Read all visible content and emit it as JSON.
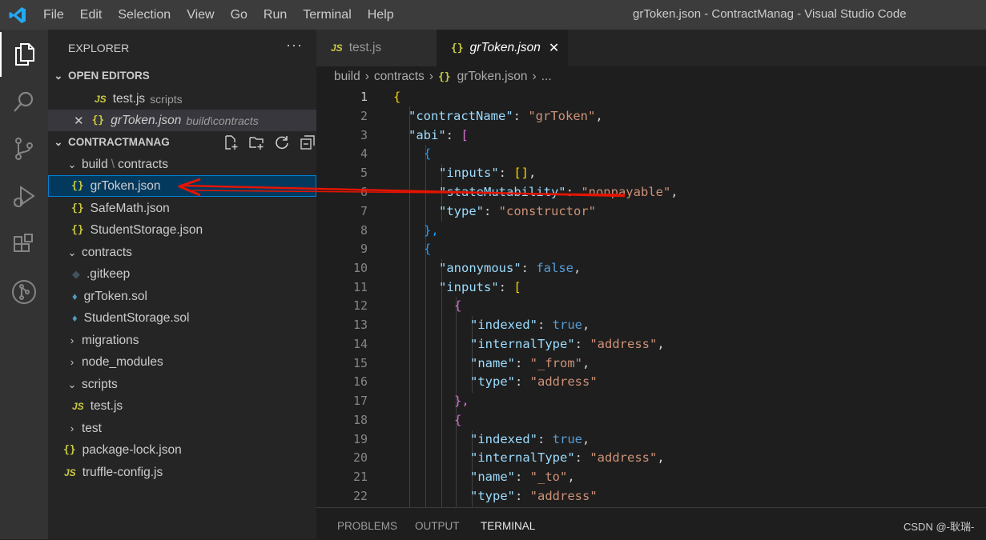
{
  "app": {
    "title": "grToken.json - ContractManag - Visual Studio Code"
  },
  "menu": [
    "File",
    "Edit",
    "Selection",
    "View",
    "Go",
    "Run",
    "Terminal",
    "Help"
  ],
  "activity": [
    "files-icon",
    "search-icon",
    "source-control-icon",
    "run-debug-icon",
    "extensions-icon",
    "git-graph-icon"
  ],
  "sidebar": {
    "title": "EXPLORER",
    "more": "···",
    "open_editors": {
      "label": "OPEN EDITORS",
      "items": [
        {
          "icon": "JS",
          "name": "test.js",
          "path": "scripts"
        },
        {
          "icon": "{}",
          "name": "grToken.json",
          "path": "build\\contracts",
          "close": "✕"
        }
      ]
    },
    "project": {
      "label": "CONTRACTMANAG",
      "tree": [
        {
          "name": "build",
          "sep": "\\",
          "name2": "contracts"
        },
        {
          "name": "grToken.json"
        },
        {
          "name": "SafeMath.json"
        },
        {
          "name": "StudentStorage.json"
        },
        {
          "name": "contracts"
        },
        {
          "name": ".gitkeep"
        },
        {
          "name": "grToken.sol"
        },
        {
          "name": "StudentStorage.sol"
        },
        {
          "name": "migrations"
        },
        {
          "name": "node_modules"
        },
        {
          "name": "scripts"
        },
        {
          "name": "test.js"
        },
        {
          "name": "test"
        },
        {
          "name": "package-lock.json"
        },
        {
          "name": "truffle-config.js"
        }
      ]
    }
  },
  "tabs": [
    {
      "icon": "JS",
      "label": "test.js"
    },
    {
      "icon": "{}",
      "label": "grToken.json",
      "close": "✕"
    }
  ],
  "breadcrumb": [
    "build",
    "contracts",
    "grToken.json",
    "..."
  ],
  "editor": {
    "lines": [
      "1",
      "2",
      "3",
      "4",
      "5",
      "6",
      "7",
      "8",
      "9",
      "10",
      "11",
      "12",
      "13",
      "14",
      "15",
      "16",
      "17",
      "18",
      "19",
      "20",
      "21",
      "22"
    ],
    "code": {
      "l1": "{",
      "l2k": "\"contractName\"",
      "l2v": "\"grToken\"",
      "l3k": "\"abi\"",
      "l3v": "[",
      "l4": "{",
      "l5k": "\"inputs\"",
      "l5v": "[]",
      "l6k": "\"stateMutability\"",
      "l6v": "\"nonpayable\"",
      "l7k": "\"type\"",
      "l7v": "\"constructor\"",
      "l8": "},",
      "l9": "{",
      "l10k": "\"anonymous\"",
      "l10v": "false",
      "l11k": "\"inputs\"",
      "l11v": "[",
      "l12": "{",
      "l13k": "\"indexed\"",
      "l13v": "true",
      "l14k": "\"internalType\"",
      "l14v": "\"address\"",
      "l15k": "\"name\"",
      "l15v": "\"_from\"",
      "l16k": "\"type\"",
      "l16v": "\"address\"",
      "l17": "},",
      "l18": "{",
      "l19k": "\"indexed\"",
      "l19v": "true",
      "l20k": "\"internalType\"",
      "l20v": "\"address\"",
      "l21k": "\"name\"",
      "l21v": "\"_to\"",
      "l22k": "\"type\"",
      "l22v": "\"address\""
    }
  },
  "panel": {
    "tabs": [
      "PROBLEMS",
      "OUTPUT",
      "TERMINAL"
    ],
    "active": "TERMINAL"
  },
  "watermark": "CSDN @-耿瑞-",
  "colors": {
    "accent": "#007acc",
    "annotation_arrow": "#e51400"
  }
}
